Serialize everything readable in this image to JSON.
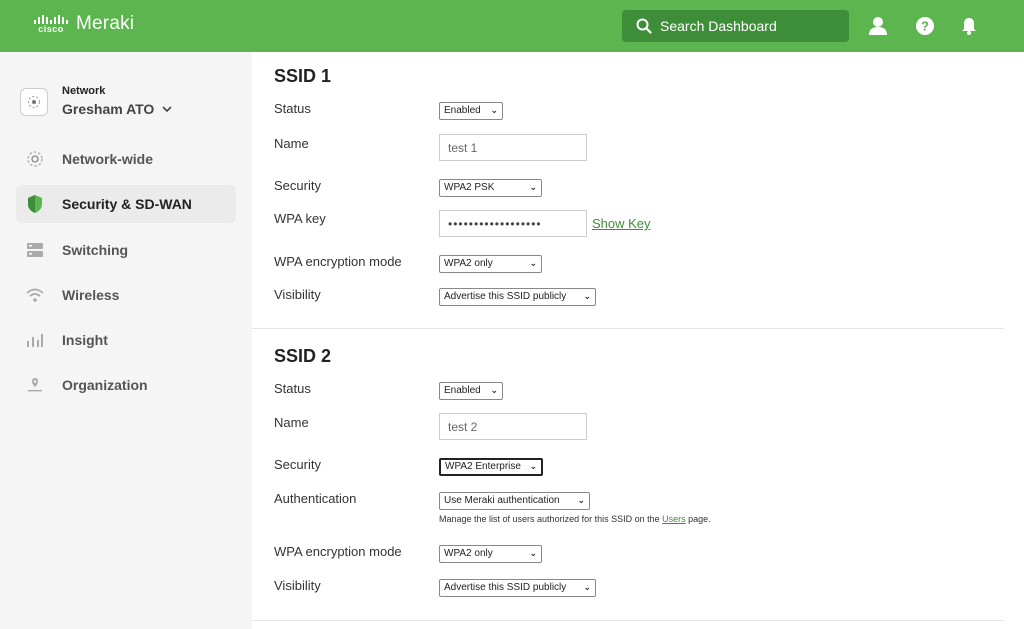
{
  "header": {
    "brand": "Meraki",
    "cisco": "cisco",
    "search_placeholder": "Search Dashboard"
  },
  "sidebar": {
    "network_label": "Network",
    "network_name": "Gresham ATO",
    "items": [
      {
        "label": "Network-wide",
        "icon": "network-wide-icon"
      },
      {
        "label": "Security & SD-WAN",
        "icon": "shield-icon",
        "active": true
      },
      {
        "label": "Switching",
        "icon": "switch-icon"
      },
      {
        "label": "Wireless",
        "icon": "wifi-icon"
      },
      {
        "label": "Insight",
        "icon": "bar-chart-icon"
      },
      {
        "label": "Organization",
        "icon": "organization-icon"
      }
    ]
  },
  "ssid1": {
    "title": "SSID 1",
    "status_label": "Status",
    "status_value": "Enabled",
    "name_label": "Name",
    "name_value": "test 1",
    "security_label": "Security",
    "security_value": "WPA2 PSK",
    "wpakey_label": "WPA key",
    "wpakey_value": "••••••••••••••••••",
    "show_key": "Show Key",
    "encryption_label": "WPA encryption mode",
    "encryption_value": "WPA2 only",
    "visibility_label": "Visibility",
    "visibility_value": "Advertise this SSID publicly"
  },
  "ssid2": {
    "title": "SSID 2",
    "status_label": "Status",
    "status_value": "Enabled",
    "name_label": "Name",
    "name_value": "test 2",
    "security_label": "Security",
    "security_value": "WPA2 Enterprise",
    "auth_label": "Authentication",
    "auth_value": "Use Meraki authentication",
    "auth_help_prefix": "Manage the list of users authorized for this SSID on the ",
    "auth_help_link": "Users",
    "auth_help_suffix": " page.",
    "encryption_label": "WPA encryption mode",
    "encryption_value": "WPA2 only",
    "visibility_label": "Visibility",
    "visibility_value": "Advertise this SSID publicly"
  },
  "colors": {
    "brand_green": "#5cb54e",
    "search_bg": "#3e8e39",
    "link_green": "#3e8e39"
  }
}
